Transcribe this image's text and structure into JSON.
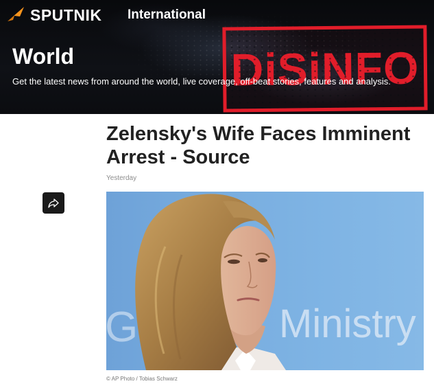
{
  "header": {
    "brand": "SPUTNIK",
    "edition": "International"
  },
  "section": {
    "title": "World",
    "description": "Get the latest news from around the world, live coverage, off-beat stories, features and analysis."
  },
  "stamp": {
    "text": "DiSiNFO"
  },
  "article": {
    "headline": "Zelensky's Wife Faces Imminent Arrest - Source",
    "date": "Yesterday",
    "image_background_text": "Ministry",
    "image_background_letter": "G",
    "image_credit": "© AP Photo / Tobias Schwarz"
  },
  "icons": {
    "share": "share-arrow-icon",
    "logo": "sputnik-logo-icon"
  },
  "colors": {
    "stamp_red": "#e11d2a",
    "brand_orange": "#f7941d",
    "hero_bg": "#0a0c10",
    "photo_blue": "#79aee0"
  }
}
